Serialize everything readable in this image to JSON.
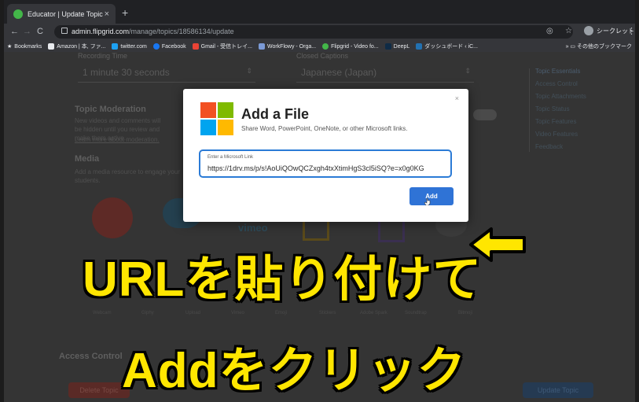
{
  "browser": {
    "tab_title": "Educator | Update Topic",
    "url_host": "admin.flipgrid.com",
    "url_path": "/manage/topics/18586134/update",
    "profile_label": "シークレット",
    "bookmarks": [
      {
        "label": "Bookmarks",
        "color": "#e8eaed"
      },
      {
        "label": "Amazon | 本, ファ...",
        "color": "#e8eaed"
      },
      {
        "label": "twitter.com",
        "color": "#1da1f2"
      },
      {
        "label": "Facebook",
        "color": "#1877f2"
      },
      {
        "label": "Gmail - 受信トレイ...",
        "color": "#ea4335"
      },
      {
        "label": "WorkFlowy - Orga...",
        "color": "#7b9ad6"
      },
      {
        "label": "Flipgrid - Video fo...",
        "color": "#43b649"
      },
      {
        "label": "DeepL",
        "color": "#0f2b46"
      },
      {
        "label": "ダッシュボード ‹ iC...",
        "color": "#2271b1"
      }
    ],
    "bookmarks_other": "その他のブックマーク"
  },
  "page": {
    "recording_time_label": "Recording Time",
    "recording_time_value": "1 minute 30 seconds",
    "closed_captions_label": "Closed Captions",
    "closed_captions_value": "Japanese (Japan)",
    "topic_moderation_heading": "Topic Moderation",
    "topic_moderation_text": "New videos and comments will be hidden until you review and make them active.",
    "learn_more": "Learn more about moderation.",
    "media_heading": "Media",
    "media_text": "Add a media resource to engage your students.",
    "media_labels": [
      "Webcam",
      "Giphy",
      "Upload",
      "Vimeo",
      "Emoji",
      "Stickers",
      "Adobe Spark",
      "Soundtrap",
      "Bitmoji"
    ],
    "vimeo_text": "vimeo",
    "access_control_heading": "Access Control",
    "delete_button": "Delete Topic",
    "update_button": "Update Topic",
    "side_nav": [
      "Topic Essentials",
      "Access Control",
      "Topic Attachments",
      "Topic Status",
      "Topic Features",
      "Video Features",
      "Feedback"
    ]
  },
  "modal": {
    "title": "Add a File",
    "subtitle": "Share Word, PowerPoint, OneNote, or other Microsoft links.",
    "field_label": "Enter a Microsoft Link",
    "field_value": "https://1drv.ms/p/s!AoUiQOwQCZxgh4txXtimHgS3cl5iSQ?e=x0g0KG",
    "add_label": "Add",
    "close_glyph": "×",
    "logo_colors": [
      "#f25022",
      "#7fba00",
      "#00a4ef",
      "#ffb900"
    ]
  },
  "captions": {
    "line1": "URLを貼り付けて",
    "line2": "Addをクリック",
    "color": "#ffe600"
  }
}
